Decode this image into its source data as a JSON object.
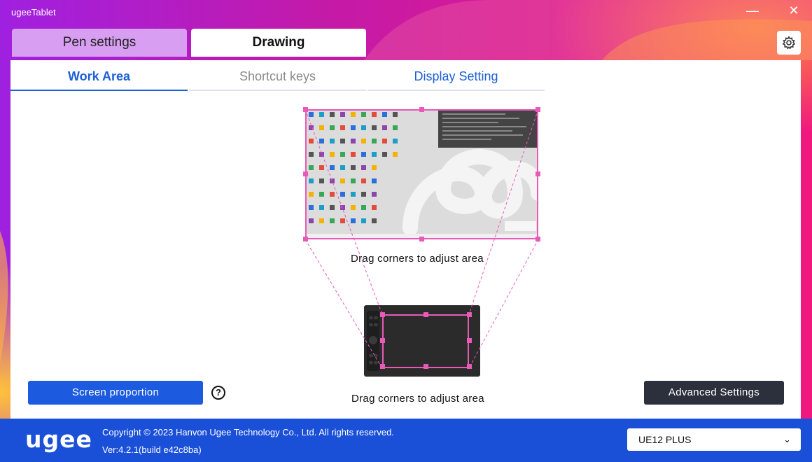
{
  "window": {
    "title": "ugeeTablet",
    "minimize_glyph": "—",
    "close_glyph": "✕"
  },
  "top_tabs": [
    {
      "label": "Pen settings",
      "active": false
    },
    {
      "label": "Drawing",
      "active": true
    }
  ],
  "sub_tabs": [
    {
      "label": "Work Area",
      "active": true
    },
    {
      "label": "Shortcut keys",
      "active": false
    },
    {
      "label": "Display Setting",
      "active": false
    }
  ],
  "work_area": {
    "screen_caption": "Drag corners to adjust area",
    "tablet_caption": "Drag corners to adjust area",
    "screen_proportion_label": "Screen proportion",
    "help_glyph": "?",
    "advanced_settings_label": "Advanced Settings"
  },
  "footer": {
    "logo": "ugee",
    "copyright": "Copyright © 2023 Hanvon Ugee Technology Co., Ltd. All rights reserved.",
    "version": "Ver:4.2.1(build e42c8ba)",
    "device_selected": "UE12 PLUS",
    "device_chevron": "⌄"
  },
  "colors": {
    "accent_blue": "#1c5be0",
    "area_frame_pink": "#e85ab8",
    "footer_blue": "#1a4fd8",
    "dark_button": "#2b303c"
  },
  "icons": [
    "settings-gear-icon",
    "minimize-icon",
    "close-icon",
    "help-icon",
    "chevron-down-icon"
  ]
}
